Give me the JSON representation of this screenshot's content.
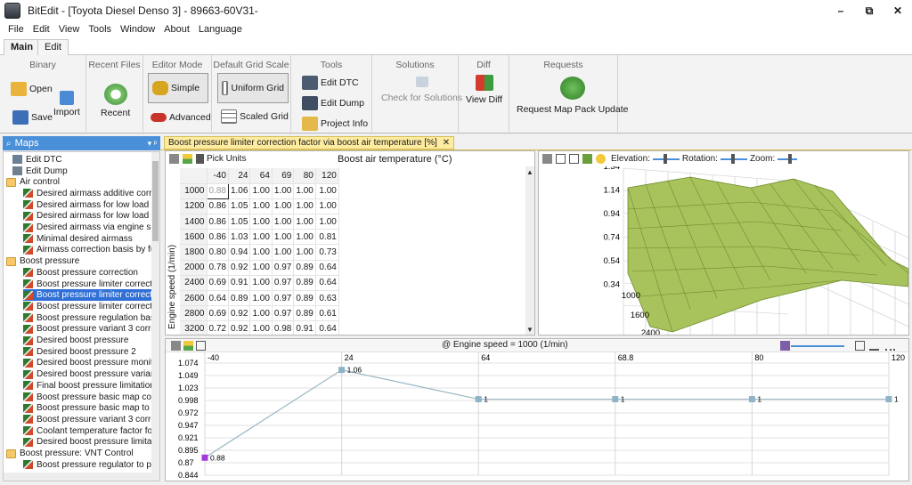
{
  "window": {
    "title": "BitEdit - [Toyota Diesel Denso 3] - 89663-60V31-",
    "minimize": "–",
    "restore": "⧉",
    "close": "✕"
  },
  "menu": [
    "File",
    "Edit",
    "View",
    "Tools",
    "Window",
    "About",
    "Language"
  ],
  "ribbon_tabs": [
    "Main",
    "Edit"
  ],
  "ribbon": {
    "binary": {
      "title": "Binary",
      "open": "Open",
      "save": "Save",
      "import": "Import"
    },
    "recent": {
      "title": "Recent Files",
      "recent": "Recent"
    },
    "editor_mode": {
      "title": "Editor Mode",
      "simple": "Simple",
      "advanced": "Advanced"
    },
    "grid_scale": {
      "title": "Default Grid Scale",
      "uniform": "Uniform Grid",
      "scaled": "Scaled Grid"
    },
    "tools": {
      "title": "Tools",
      "edit_dtc": "Edit DTC",
      "edit_dump": "Edit Dump",
      "project_info": "Project Info"
    },
    "solutions": {
      "title": "Solutions",
      "check": "Check for Solutions"
    },
    "diff": {
      "title": "Diff",
      "view_diff": "View Diff"
    },
    "requests": {
      "title": "Requests",
      "update": "Request Map Pack Update"
    }
  },
  "sidebar": {
    "title": "Maps",
    "pin": "▾ ᵖ",
    "items": [
      {
        "label": "Edit DTC",
        "icon": "dtc",
        "indent": 1
      },
      {
        "label": "Edit Dump",
        "icon": "dump",
        "indent": 1
      },
      {
        "label": "Air control",
        "icon": "folder",
        "indent": 0
      },
      {
        "label": "Desired airmass additive correc",
        "icon": "map",
        "indent": 2
      },
      {
        "label": "Desired airmass for low load (3)",
        "icon": "map",
        "indent": 2
      },
      {
        "label": "Desired airmass for low load va",
        "icon": "map",
        "indent": 2
      },
      {
        "label": "Desired airmass via engine spee",
        "icon": "map",
        "indent": 2
      },
      {
        "label": "Minimal desired airmass",
        "icon": "map",
        "indent": 2
      },
      {
        "label": "Airmass correction basis by fuel",
        "icon": "map",
        "indent": 2
      },
      {
        "label": "Boost pressure",
        "icon": "folder",
        "indent": 0
      },
      {
        "label": "Boost pressure correction",
        "icon": "map",
        "indent": 2
      },
      {
        "label": "Boost pressure limiter correctio",
        "icon": "map",
        "indent": 2
      },
      {
        "label": "Boost pressure limiter correctio",
        "icon": "map",
        "indent": 2,
        "selected": true
      },
      {
        "label": "Boost pressure limiter correctio",
        "icon": "map",
        "indent": 2
      },
      {
        "label": "Boost pressure regulation basis",
        "icon": "map",
        "indent": 2
      },
      {
        "label": "Boost pressure variant 3 correct",
        "icon": "map",
        "indent": 2
      },
      {
        "label": "Desired boost pressure",
        "icon": "map",
        "indent": 2
      },
      {
        "label": "Desired boost pressure 2",
        "icon": "map",
        "indent": 2
      },
      {
        "label": "Desired boost pressure monitor",
        "icon": "map",
        "indent": 2
      },
      {
        "label": "Desired boost pressure variant",
        "icon": "map",
        "indent": 2
      },
      {
        "label": "Final boost pressure limitation(",
        "icon": "map",
        "indent": 2
      },
      {
        "label": "Boost pressure basic map corre",
        "icon": "map",
        "indent": 2
      },
      {
        "label": "Boost pressure basic map to lim",
        "icon": "map",
        "indent": 2
      },
      {
        "label": "Boost pressure variant 3 correct",
        "icon": "map",
        "indent": 2
      },
      {
        "label": "Coolant temperature factor for",
        "icon": "map",
        "indent": 2
      },
      {
        "label": "Desired boost pressure limitatic",
        "icon": "map",
        "indent": 2
      },
      {
        "label": "Boost pressure: VNT Control",
        "icon": "folder",
        "indent": 0
      },
      {
        "label": "Boost pressure regulator to pre",
        "icon": "map",
        "indent": 2
      }
    ]
  },
  "doc_tab": {
    "label": "Boost pressure limiter correction factor via boost air temperature [%]",
    "close": "✕"
  },
  "grid": {
    "pick_units": "Pick Units",
    "x_title": "Boost air temperature (°C)",
    "y_title": "Engine speed (1/min)",
    "columns": [
      "-40",
      "24",
      "64",
      "69",
      "80",
      "120"
    ],
    "rows": [
      {
        "rpm": "1000",
        "values": [
          "0.88",
          "1.06",
          "1.00",
          "1.00",
          "1.00",
          "1.00"
        ]
      },
      {
        "rpm": "1200",
        "values": [
          "0.86",
          "1.05",
          "1.00",
          "1.00",
          "1.00",
          "1.00"
        ]
      },
      {
        "rpm": "1400",
        "values": [
          "0.86",
          "1.05",
          "1.00",
          "1.00",
          "1.00",
          "1.00"
        ]
      },
      {
        "rpm": "1600",
        "values": [
          "0.86",
          "1.03",
          "1.00",
          "1.00",
          "1.00",
          "0.81"
        ]
      },
      {
        "rpm": "1800",
        "values": [
          "0.80",
          "0.94",
          "1.00",
          "1.00",
          "1.00",
          "0.73"
        ]
      },
      {
        "rpm": "2000",
        "values": [
          "0.78",
          "0.92",
          "1.00",
          "0.97",
          "0.89",
          "0.64"
        ]
      },
      {
        "rpm": "2400",
        "values": [
          "0.69",
          "0.91",
          "1.00",
          "0.97",
          "0.89",
          "0.64"
        ]
      },
      {
        "rpm": "2600",
        "values": [
          "0.64",
          "0.89",
          "1.00",
          "0.97",
          "0.89",
          "0.63"
        ]
      },
      {
        "rpm": "2800",
        "values": [
          "0.69",
          "0.92",
          "1.00",
          "0.97",
          "0.89",
          "0.61"
        ]
      },
      {
        "rpm": "3200",
        "values": [
          "0.72",
          "0.92",
          "1.00",
          "0.98",
          "0.91",
          "0.64"
        ]
      }
    ]
  },
  "plot3d": {
    "elevation_label": "Elevation:",
    "rotation_label": "Rotation:",
    "zoom_label": "Zoom:",
    "z_ticks": [
      "1.34",
      "1.14",
      "0.94",
      "0.74",
      "0.54",
      "0.34"
    ],
    "y_ticks": [
      "1000",
      "1600",
      "2400"
    ]
  },
  "line_chart": {
    "caption": "@ Engine speed = 1000 (1/min)",
    "x_ticks": [
      "-40",
      "24",
      "64",
      "68.8",
      "80",
      "120"
    ],
    "y_ticks": [
      "1.074",
      "1.049",
      "1.023",
      "0.998",
      "0.972",
      "0.947",
      "0.921",
      "0.895",
      "0.87",
      "0.844"
    ],
    "point_labels": [
      "0.88",
      "1.06",
      "1",
      "1",
      "1",
      "1"
    ],
    "ylim": [
      0.844,
      1.074
    ]
  },
  "chart_data": {
    "type": "line",
    "x": [
      -40,
      24,
      64,
      68.8,
      80,
      120
    ],
    "series": [
      {
        "values": [
          0.88,
          1.06,
          1,
          1,
          1,
          1
        ]
      }
    ],
    "ylim": [
      0.844,
      1.074
    ],
    "grid": true
  }
}
